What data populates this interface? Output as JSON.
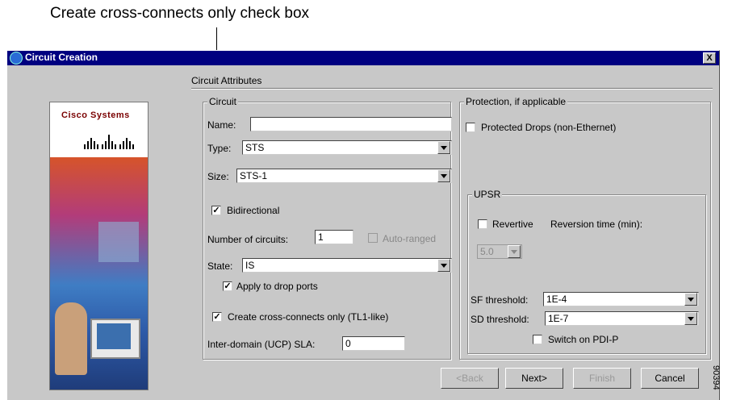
{
  "callout": "Create cross-connects only check box",
  "window": {
    "title": "Circuit Creation",
    "close": "X"
  },
  "sidebar": {
    "logo": "Cisco Systems"
  },
  "circuit_attributes": {
    "label": "Circuit Attributes",
    "circuit_group": {
      "title": "Circuit",
      "name_label": "Name:",
      "name_value": "",
      "type_label": "Type:",
      "type_value": "STS",
      "size_label": "Size:",
      "size_value": "STS-1",
      "bidirectional_label": "Bidirectional",
      "bidirectional_checked": true,
      "num_circuits_label": "Number of circuits:",
      "num_circuits_value": "1",
      "auto_ranged_label": "Auto-ranged",
      "state_label": "State:",
      "state_value": "IS",
      "apply_drop_label": "Apply to drop ports",
      "apply_drop_checked": true,
      "cross_connect_label": "Create cross-connects only (TL1-like)",
      "cross_connect_checked": true,
      "sla_label": "Inter-domain (UCP) SLA:",
      "sla_value": "0"
    },
    "protection_group": {
      "title": "Protection, if applicable",
      "protected_drops_label": "Protected Drops (non-Ethernet)",
      "upsr": {
        "title": "UPSR",
        "revertive_label": "Revertive",
        "reversion_label": "Reversion time (min):",
        "reversion_value": "5.0",
        "sf_label": "SF threshold:",
        "sf_value": "1E-4",
        "sd_label": "SD threshold:",
        "sd_value": "1E-7",
        "switch_pdi_label": "Switch on PDI-P"
      }
    }
  },
  "buttons": {
    "back": "<Back",
    "next": "Next>",
    "finish": "Finish",
    "cancel": "Cancel"
  },
  "figure_id": "90394",
  "check_mark": "✓"
}
